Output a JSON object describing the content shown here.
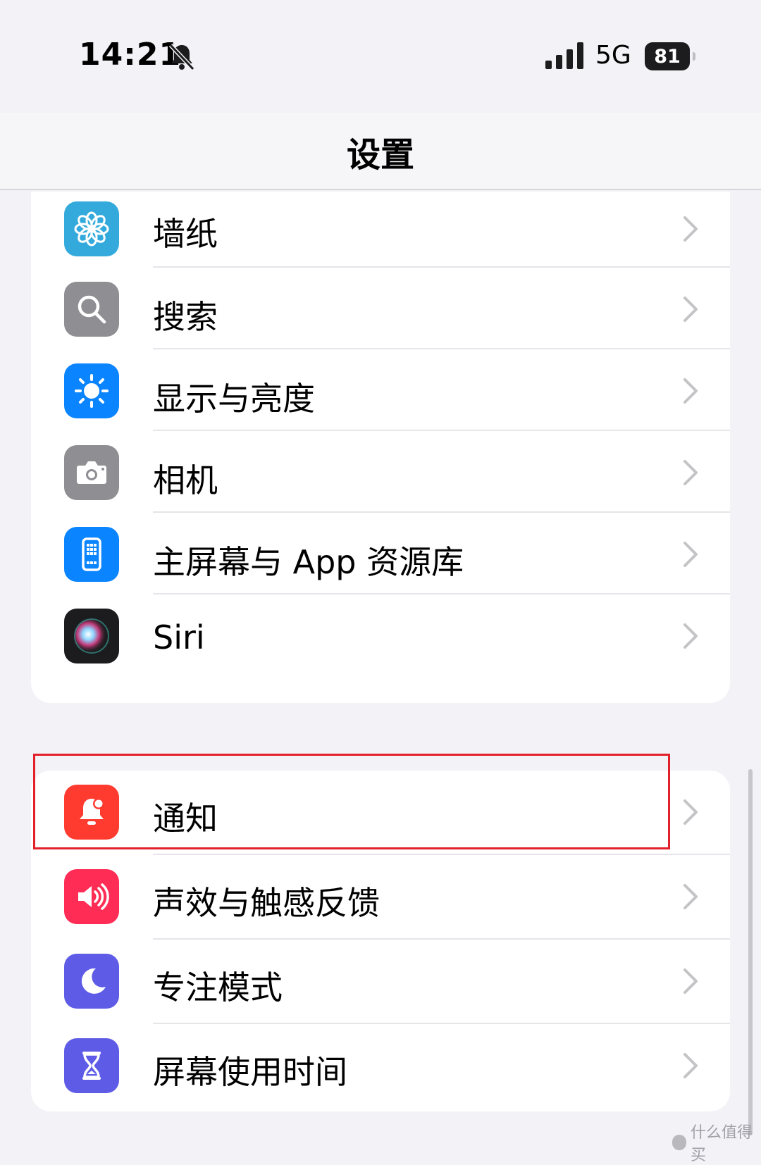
{
  "status_bar": {
    "time": "14:21",
    "network": "5G",
    "battery": "81",
    "icons": [
      "bell-slash-icon",
      "cellular-signal-icon",
      "battery-icon"
    ]
  },
  "nav": {
    "title": "设置"
  },
  "group1": {
    "items": [
      {
        "label": "墙纸",
        "icon": "wallpaper-flower-icon",
        "color": "#34aadc"
      },
      {
        "label": "搜索",
        "icon": "magnifier-icon",
        "color": "#8e8e93"
      },
      {
        "label": "显示与亮度",
        "icon": "sun-icon",
        "color": "#0a84ff"
      },
      {
        "label": "相机",
        "icon": "camera-icon",
        "color": "#8e8e93"
      },
      {
        "label": "主屏幕与 App 资源库",
        "icon": "home-screen-icon",
        "color": "#0a84ff"
      },
      {
        "label": "Siri",
        "icon": "siri-orb-icon",
        "color": "#1c1c1e"
      }
    ]
  },
  "group2": {
    "items": [
      {
        "label": "通知",
        "icon": "notification-bell-icon",
        "color": "#ff3b30"
      },
      {
        "label": "声效与触感反馈",
        "icon": "speaker-icon",
        "color": "#ff2d55"
      },
      {
        "label": "专注模式",
        "icon": "moon-icon",
        "color": "#5e5ce6"
      },
      {
        "label": "屏幕使用时间",
        "icon": "hourglass-icon",
        "color": "#5e5ce6"
      }
    ]
  },
  "watermark": "什么值得买"
}
